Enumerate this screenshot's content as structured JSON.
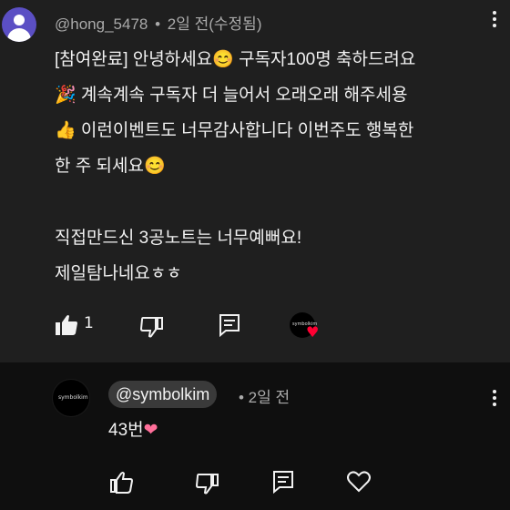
{
  "comment": {
    "author": "@hong_5478",
    "separator": "•",
    "time": "2일 전(수정됨)",
    "lines": [
      "[참여완료] 안녕하세요😊 구독자100명 축하드려요",
      "🎉 계속계속 구독자 더 늘어서 오래오래  해주세용",
      "👍 이런이벤트도 너무감사합니다 이번주도 행복한",
      "한 주 되세요😊",
      "직접만드신 3공노트는 너무예뻐요!",
      "제일탐나네요ㅎㅎ"
    ],
    "like_count": "1",
    "heart_avatar_text": "symbolkim",
    "heart_glyph": "♥"
  },
  "reply": {
    "avatar_text": "symbolkim",
    "handle": "@symbolkim",
    "time": "• 2일 전",
    "text": "43번",
    "heart_emoji": "❤"
  },
  "colors": {
    "comment_bg": "#1f1f1f",
    "reply_bg": "#0f0f0f",
    "meta_text": "#aaaaaa",
    "avatar_purple": "#5b4fc4",
    "heart_red": "#ff0033"
  },
  "icons": {
    "like": "thumbs-up-filled-icon",
    "dislike": "thumbs-down-icon",
    "reply": "comment-reply-icon",
    "more": "kebab-menu-icon",
    "heart_outline": "heart-outline-icon"
  }
}
